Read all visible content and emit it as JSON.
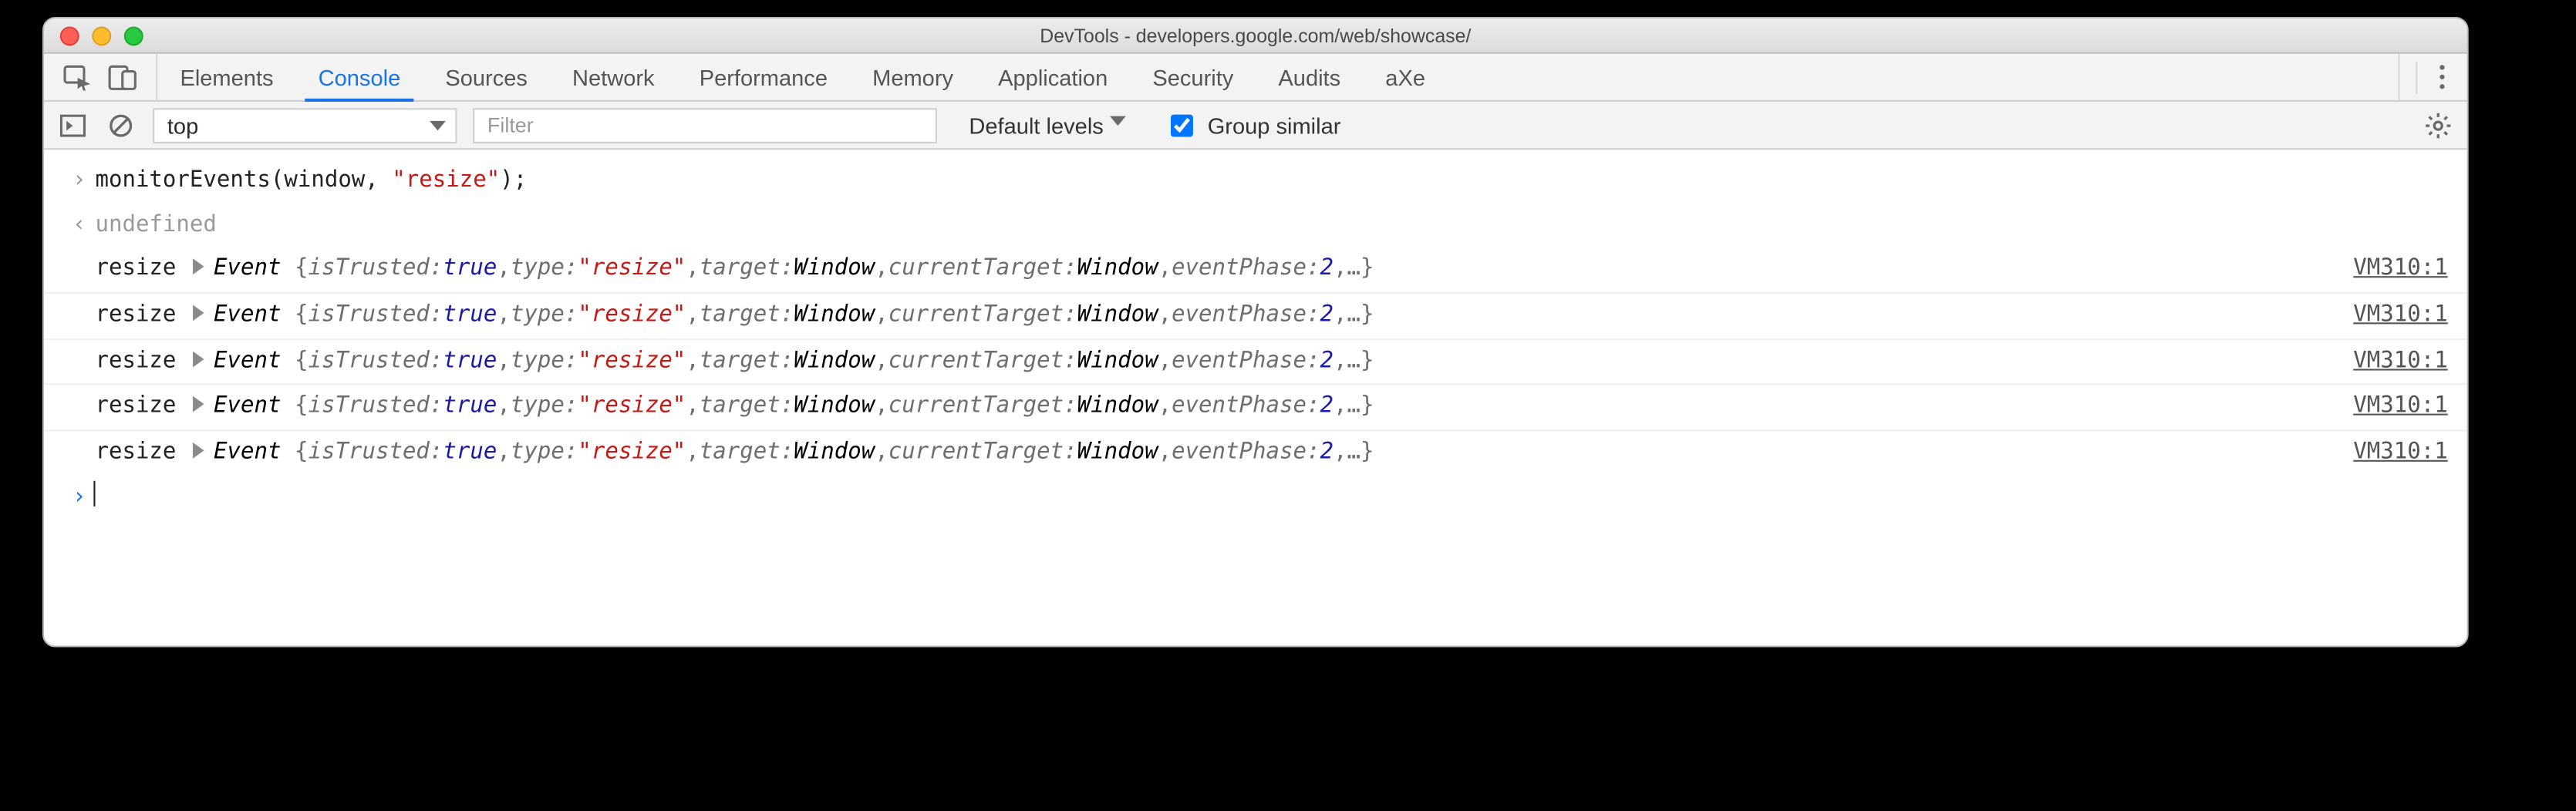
{
  "window": {
    "title": "DevTools - developers.google.com/web/showcase/"
  },
  "tabs": {
    "items": [
      "Elements",
      "Console",
      "Sources",
      "Network",
      "Performance",
      "Memory",
      "Application",
      "Security",
      "Audits",
      "aXe"
    ],
    "activeIndex": 1
  },
  "toolbar": {
    "context": "top",
    "filter_placeholder": "Filter",
    "filter_value": "",
    "levels_label": "Default levels",
    "group_similar_label": "Group similar",
    "group_similar_checked": true
  },
  "input": {
    "fn": "monitorEvents",
    "arg_obj": "window",
    "arg_str": "\"resize\"",
    "result": "undefined"
  },
  "event": {
    "label": "resize",
    "className": "Event",
    "props": {
      "isTrusted_k": "isTrusted",
      "isTrusted_v": "true",
      "type_k": "type",
      "type_v": "\"resize\"",
      "target_k": "target",
      "target_v": "Window",
      "currentTarget_k": "currentTarget",
      "currentTarget_v": "Window",
      "eventPhase_k": "eventPhase",
      "eventPhase_v": "2"
    },
    "ellipsis": "…",
    "source": "VM310:1",
    "count": 5
  }
}
